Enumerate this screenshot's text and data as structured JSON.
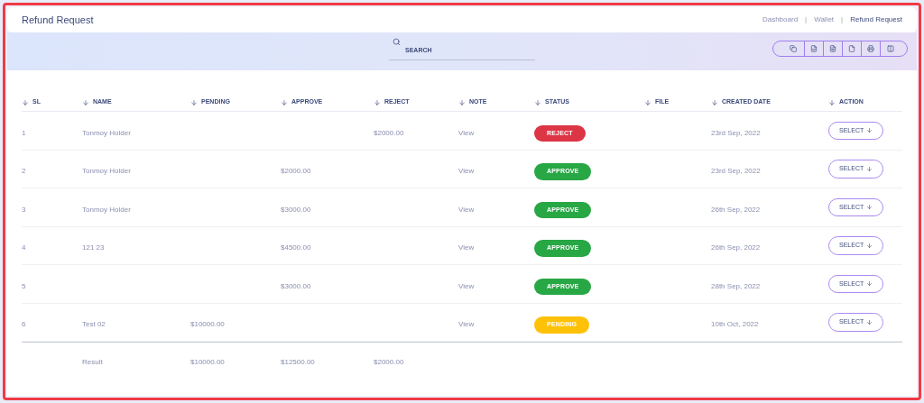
{
  "title": "Refund Request",
  "breadcrumb": [
    {
      "label": "Dashboard",
      "selected": false
    },
    {
      "separator": "|",
      "label": "Wallet",
      "selected": false
    },
    {
      "separator": "|",
      "label": "Refund Request",
      "selected": true
    }
  ],
  "search": {
    "placeholder": "SEARCH"
  },
  "table": {
    "columns": [
      "SL",
      "NAME",
      "PENDING",
      "APPROVE",
      "REJECT",
      "NOTE",
      "STATUS",
      "FILE",
      "CREATED DATE",
      "ACTION"
    ],
    "rows": [
      {
        "sl": "1",
        "name": "Tonmoy Holder",
        "pending": "",
        "approve": "",
        "reject": "$2000.00",
        "note": "View",
        "status": {
          "label": "REJECT",
          "kind": "reject"
        },
        "created": "23rd Sep, 2022",
        "action": "SELECT"
      },
      {
        "sl": "2",
        "name": "Tonmoy Holder",
        "pending": "",
        "approve": "$2000.00",
        "reject": "",
        "note": "View",
        "status": {
          "label": "APPROVE",
          "kind": "approve"
        },
        "created": "23rd Sep, 2022",
        "action": "SELECT"
      },
      {
        "sl": "3",
        "name": "Tonmoy Holder",
        "pending": "",
        "approve": "$3000.00",
        "reject": "",
        "note": "View",
        "status": {
          "label": "APPROVE",
          "kind": "approve"
        },
        "created": "26th Sep, 2022",
        "action": "SELECT"
      },
      {
        "sl": "4",
        "name": "121 23",
        "pending": "",
        "approve": "$4500.00",
        "reject": "",
        "note": "View",
        "status": {
          "label": "APPROVE",
          "kind": "approve"
        },
        "created": "26th Sep, 2022",
        "action": "SELECT"
      },
      {
        "sl": "5",
        "name": "",
        "pending": "",
        "approve": "$3000.00",
        "reject": "",
        "note": "View",
        "status": {
          "label": "APPROVE",
          "kind": "approve"
        },
        "created": "28th Sep, 2022",
        "action": "SELECT"
      },
      {
        "sl": "6",
        "name": "Test 02",
        "pending": "$10000.00",
        "approve": "",
        "reject": "",
        "note": "View",
        "status": {
          "label": "PENDING",
          "kind": "pending"
        },
        "created": "10th Oct, 2022",
        "action": "SELECT"
      }
    ],
    "footer": {
      "label": "Result",
      "pending": "$10000.00",
      "approve": "$12500.00",
      "reject": "$2000.00"
    }
  }
}
